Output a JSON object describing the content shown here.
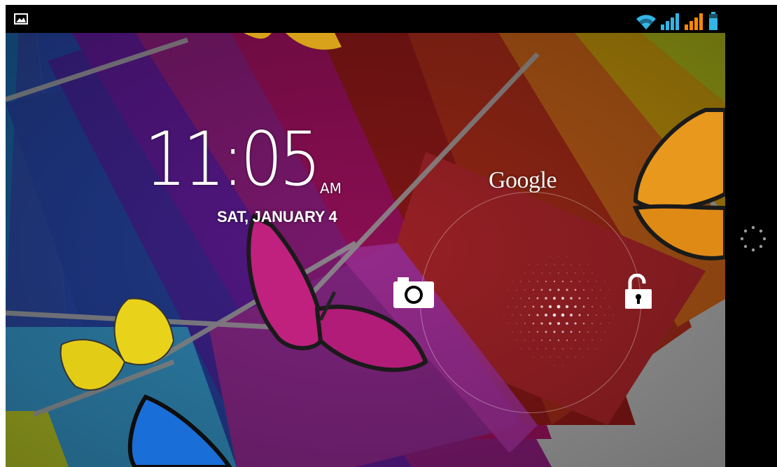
{
  "clock": {
    "time": "11:05",
    "ampm": "AM"
  },
  "date": "SAT, JANUARY 4",
  "search": {
    "label": "Google"
  },
  "status_bar": {
    "icons": [
      "image-notification-icon",
      "wifi-icon",
      "signal-icon",
      "signal-icon",
      "battery-icon"
    ],
    "colors": {
      "wifi": "#33b5e5",
      "signal_1": "#33b5e5",
      "signal_2": "#ff8800",
      "battery": "#33b5e5"
    }
  },
  "lockscreen": {
    "targets": [
      "camera-icon",
      "unlock-icon"
    ],
    "handle_icon": "dotted-handle-icon"
  },
  "nav_bar": {
    "icons": [
      "loading-icon"
    ]
  }
}
